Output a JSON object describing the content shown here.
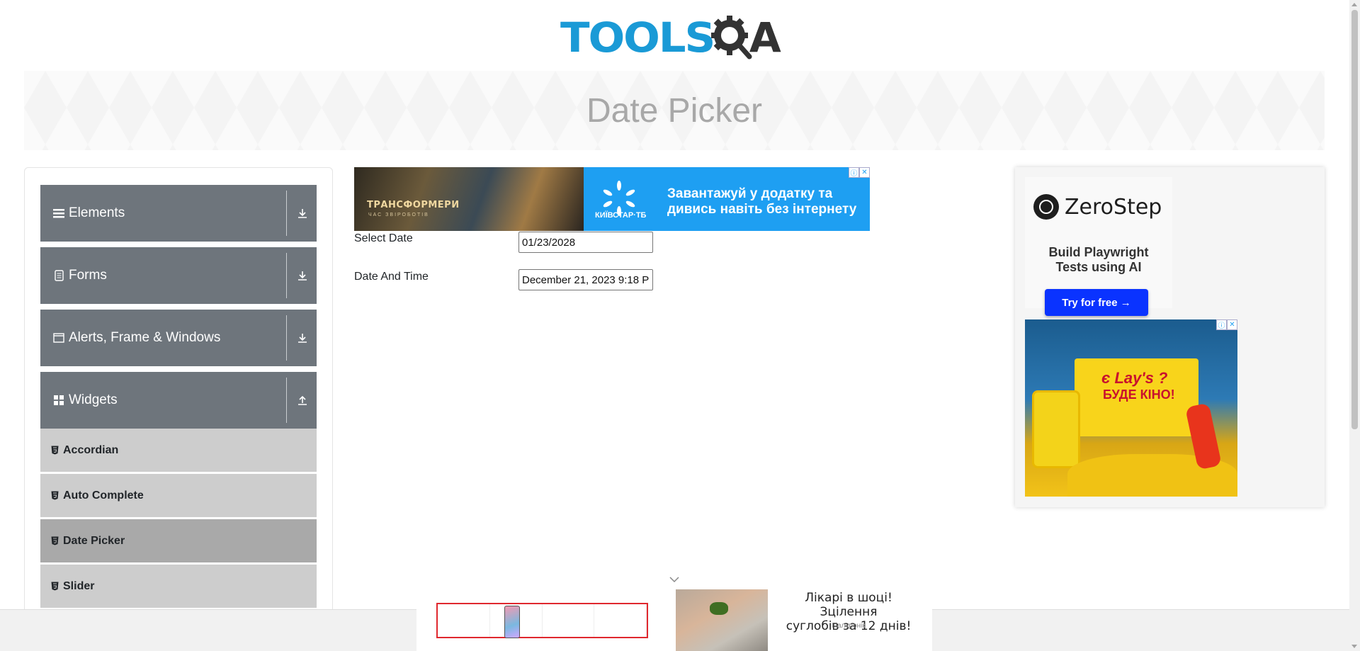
{
  "header": {
    "logo_text_main": "TOOLS",
    "logo_text_end": "A",
    "logo_colors": {
      "tools": "#1a9ad6",
      "qa": "#333333"
    }
  },
  "banner": {
    "title": "Date Picker"
  },
  "sidebar": {
    "groups": [
      {
        "label": "Elements",
        "icon": "hamburger-icon",
        "arrow": "download-arrow-icon"
      },
      {
        "label": "Forms",
        "icon": "document-icon",
        "arrow": "download-arrow-icon"
      },
      {
        "label": "Alerts, Frame & Windows",
        "icon": "window-icon",
        "arrow": "download-arrow-icon"
      },
      {
        "label": "Widgets",
        "icon": "grid-icon",
        "arrow": "upload-arrow-icon"
      }
    ],
    "widget_items": [
      {
        "label": "Accordian",
        "active": false
      },
      {
        "label": "Auto Complete",
        "active": false
      },
      {
        "label": "Date Picker",
        "active": true
      },
      {
        "label": "Slider",
        "active": false
      }
    ]
  },
  "top_ad": {
    "movie_title": "ТРАНСФОРМЕРИ",
    "movie_subtitle": "ЧАС ЗВІРОБОТІВ",
    "brand": "КИЇВСТАР·ТБ",
    "text_line1": "Завантажуй у додатку та",
    "text_line2": "дивись навіть без інтернету",
    "badges": [
      "ⓘ",
      "✕"
    ]
  },
  "form": {
    "select_date_label": "Select Date",
    "select_date_value": "01/23/2028",
    "date_time_label": "Date And Time",
    "date_time_value": "December 21, 2023 9:18 P"
  },
  "right_ad": {
    "brand": "ZeroStep",
    "subtitle_line1": "Build Playwright",
    "subtitle_line2": "Tests using AI",
    "button_label": "Try for free →",
    "lays_brand": "є Lay's ?",
    "lays_text": "БУДЕ КІНО!",
    "badges": [
      "ⓘ",
      "✕"
    ]
  },
  "bottom_ad": {
    "title_line1": "Лікарі в шоці! Зцілення",
    "title_line2": "суглобів за 12 днів!",
    "source": "Гіалуронік"
  },
  "colors": {
    "sidebar_group_bg": "#6e757c",
    "sidebar_item_bg": "#cdcdcd",
    "sidebar_item_active_bg": "#a9a9a9",
    "zerostep_button": "#0a33ff",
    "kyivstar_blue": "#1e9ff2"
  }
}
